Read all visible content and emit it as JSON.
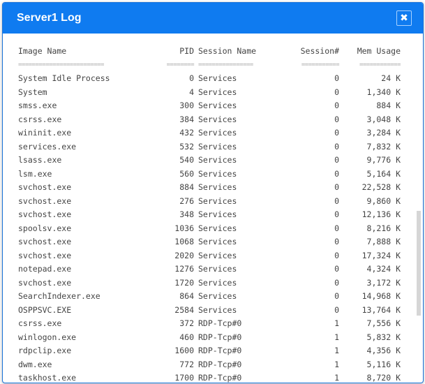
{
  "window": {
    "title": "Server1 Log",
    "close_icon": "close-x-icon"
  },
  "table": {
    "headers": {
      "name": "Image Name",
      "pid": "PID",
      "session_name": "Session Name",
      "session_num": "Session#",
      "mem": "Mem Usage"
    },
    "separators": {
      "name": "=========================",
      "pid": "========",
      "session_name": "================",
      "session_num": "===========",
      "mem": "============"
    },
    "rows": [
      {
        "name": "System Idle Process",
        "pid": "0",
        "session_name": "Services",
        "session_num": "0",
        "mem": "24 K"
      },
      {
        "name": "System",
        "pid": "4",
        "session_name": "Services",
        "session_num": "0",
        "mem": "1,340 K"
      },
      {
        "name": "smss.exe",
        "pid": "300",
        "session_name": "Services",
        "session_num": "0",
        "mem": "884 K"
      },
      {
        "name": "csrss.exe",
        "pid": "384",
        "session_name": "Services",
        "session_num": "0",
        "mem": "3,048 K"
      },
      {
        "name": "wininit.exe",
        "pid": "432",
        "session_name": "Services",
        "session_num": "0",
        "mem": "3,284 K"
      },
      {
        "name": "services.exe",
        "pid": "532",
        "session_name": "Services",
        "session_num": "0",
        "mem": "7,832 K"
      },
      {
        "name": "lsass.exe",
        "pid": "540",
        "session_name": "Services",
        "session_num": "0",
        "mem": "9,776 K"
      },
      {
        "name": "lsm.exe",
        "pid": "560",
        "session_name": "Services",
        "session_num": "0",
        "mem": "5,164 K"
      },
      {
        "name": "svchost.exe",
        "pid": "884",
        "session_name": "Services",
        "session_num": "0",
        "mem": "22,528 K"
      },
      {
        "name": "svchost.exe",
        "pid": "276",
        "session_name": "Services",
        "session_num": "0",
        "mem": "9,860 K"
      },
      {
        "name": "svchost.exe",
        "pid": "348",
        "session_name": "Services",
        "session_num": "0",
        "mem": "12,136 K"
      },
      {
        "name": "spoolsv.exe",
        "pid": "1036",
        "session_name": "Services",
        "session_num": "0",
        "mem": "8,216 K"
      },
      {
        "name": "svchost.exe",
        "pid": "1068",
        "session_name": "Services",
        "session_num": "0",
        "mem": "7,888 K"
      },
      {
        "name": "svchost.exe",
        "pid": "2020",
        "session_name": "Services",
        "session_num": "0",
        "mem": "17,324 K"
      },
      {
        "name": "notepad.exe",
        "pid": "1276",
        "session_name": "Services",
        "session_num": "0",
        "mem": "4,324 K"
      },
      {
        "name": "svchost.exe",
        "pid": "1720",
        "session_name": "Services",
        "session_num": "0",
        "mem": "3,172 K"
      },
      {
        "name": "SearchIndexer.exe",
        "pid": "864",
        "session_name": "Services",
        "session_num": "0",
        "mem": "14,968 K"
      },
      {
        "name": "OSPPSVC.EXE",
        "pid": "2584",
        "session_name": "Services",
        "session_num": "0",
        "mem": "13,764 K"
      },
      {
        "name": "csrss.exe",
        "pid": "372",
        "session_name": "RDP-Tcp#0",
        "session_num": "1",
        "mem": "7,556 K"
      },
      {
        "name": "winlogon.exe",
        "pid": "460",
        "session_name": "RDP-Tcp#0",
        "session_num": "1",
        "mem": "5,832 K"
      },
      {
        "name": "rdpclip.exe",
        "pid": "1600",
        "session_name": "RDP-Tcp#0",
        "session_num": "1",
        "mem": "4,356 K"
      },
      {
        "name": "dwm.exe",
        "pid": "772",
        "session_name": "RDP-Tcp#0",
        "session_num": "1",
        "mem": "5,116 K"
      },
      {
        "name": "taskhost.exe",
        "pid": "1700",
        "session_name": "RDP-Tcp#0",
        "session_num": "1",
        "mem": "8,720 K"
      }
    ]
  },
  "colors": {
    "header_bg": "#0f7bf0",
    "header_text": "#ffffff",
    "text": "#444444"
  }
}
